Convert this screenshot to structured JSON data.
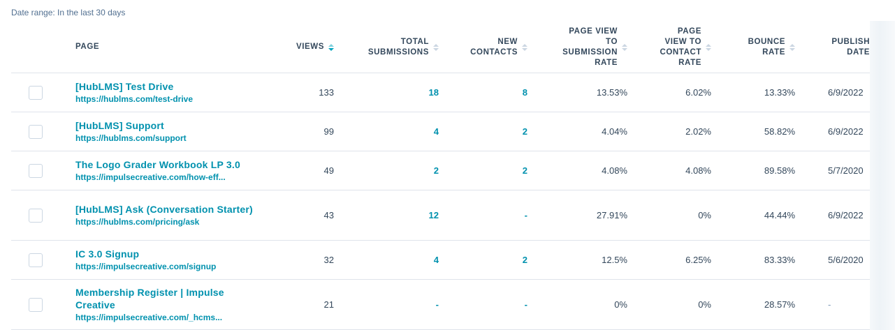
{
  "date_range": "Date range: In the last 30 days",
  "columns": {
    "page": "PAGE",
    "views": "VIEWS",
    "total_submissions": [
      "TOTAL",
      "SUBMISSIONS"
    ],
    "new_contacts": [
      "NEW",
      "CONTACTS"
    ],
    "pv_submission_rate": [
      "PAGE VIEW",
      "TO",
      "SUBMISSION",
      "RATE"
    ],
    "pv_contact_rate": [
      "PAGE",
      "VIEW TO",
      "CONTACT",
      "RATE"
    ],
    "bounce_rate": [
      "BOUNCE",
      "RATE"
    ],
    "publish_date": [
      "PUBLISH",
      "DATE"
    ]
  },
  "rows": [
    {
      "title": "[HubLMS] Test Drive",
      "url": "https://hublms.com/test-drive",
      "views": "133",
      "submissions": "18",
      "contacts": "8",
      "pv_sub_rate": "13.53%",
      "pv_contact_rate": "6.02%",
      "bounce": "13.33%",
      "publish": "6/9/2022"
    },
    {
      "title": "[HubLMS] Support",
      "url": "https://hublms.com/support",
      "views": "99",
      "submissions": "4",
      "contacts": "2",
      "pv_sub_rate": "4.04%",
      "pv_contact_rate": "2.02%",
      "bounce": "58.82%",
      "publish": "6/9/2022"
    },
    {
      "title": "The Logo Grader Workbook LP 3.0",
      "url": "https://impulsecreative.com/how-eff...",
      "views": "49",
      "submissions": "2",
      "contacts": "2",
      "pv_sub_rate": "4.08%",
      "pv_contact_rate": "4.08%",
      "bounce": "89.58%",
      "publish": "5/7/2020"
    },
    {
      "title": "[HubLMS] Ask (Conversation Starter)",
      "url": "https://hublms.com/pricing/ask",
      "views": "43",
      "submissions": "12",
      "contacts": "-",
      "pv_sub_rate": "27.91%",
      "pv_contact_rate": "0%",
      "bounce": "44.44%",
      "publish": "6/9/2022"
    },
    {
      "title": "IC 3.0 Signup",
      "url": "https://impulsecreative.com/signup",
      "views": "32",
      "submissions": "4",
      "contacts": "2",
      "pv_sub_rate": "12.5%",
      "pv_contact_rate": "6.25%",
      "bounce": "83.33%",
      "publish": "5/6/2020"
    },
    {
      "title": "Membership Register | Impulse Creative",
      "url": "https://impulsecreative.com/_hcms...",
      "views": "21",
      "submissions": "-",
      "contacts": "-",
      "pv_sub_rate": "0%",
      "pv_contact_rate": "0%",
      "bounce": "28.57%",
      "publish": "-"
    }
  ]
}
